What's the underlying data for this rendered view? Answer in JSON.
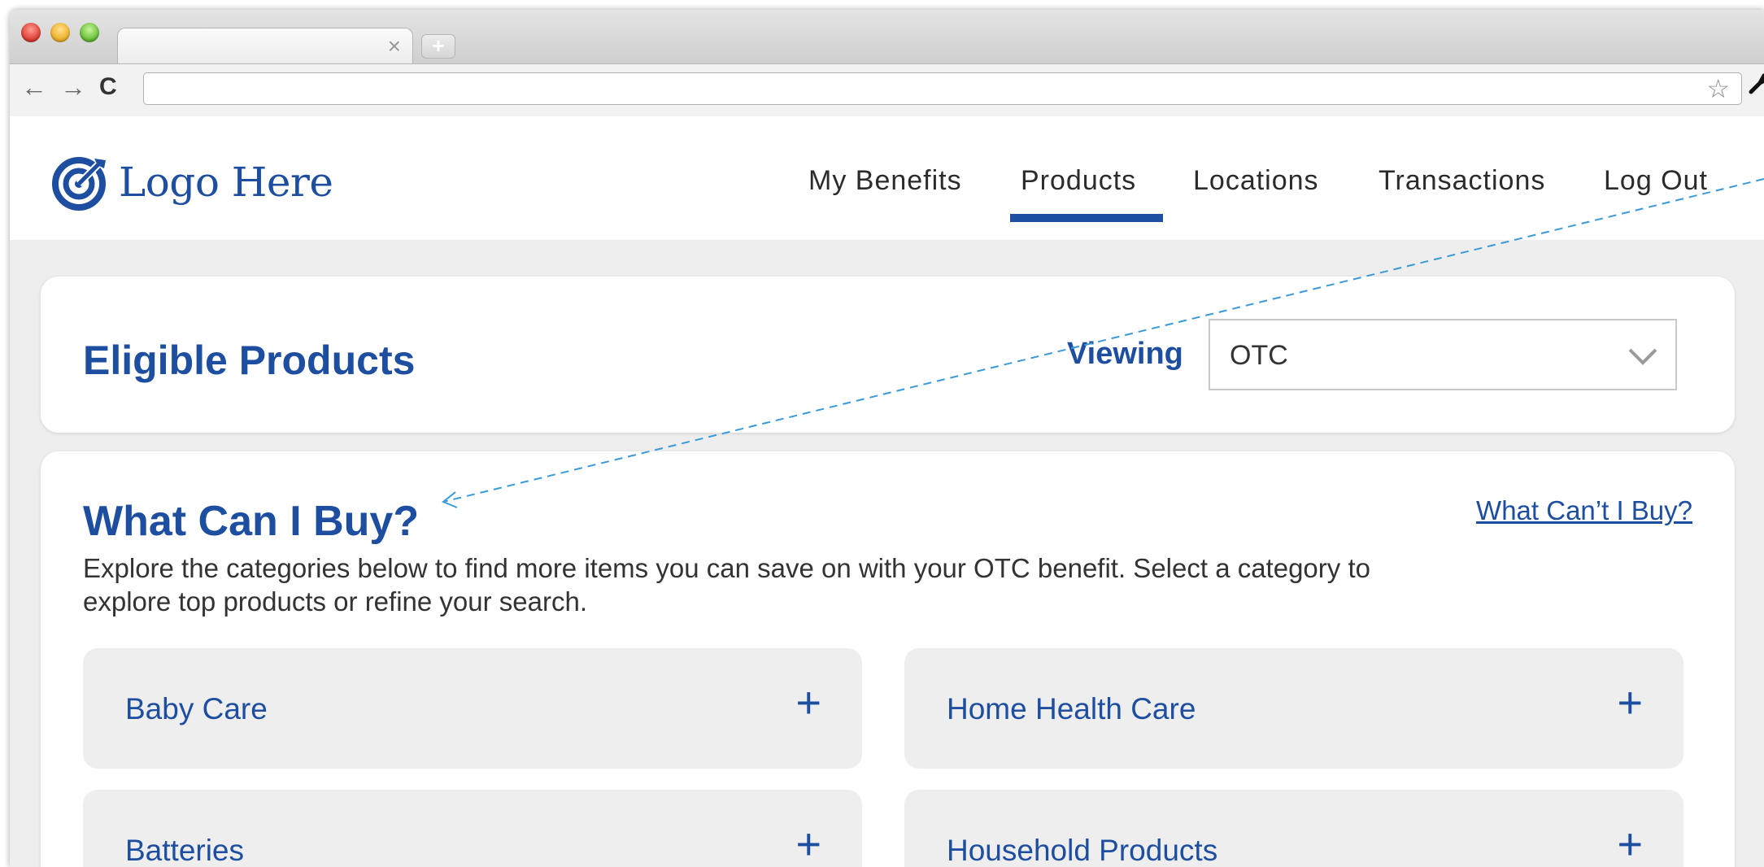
{
  "browser": {
    "tab_close": "×",
    "new_tab": "+",
    "back_icon": "←",
    "forward_icon": "→",
    "reload_icon": "C",
    "star_icon": "☆",
    "wrench_icon": "🔧"
  },
  "header": {
    "logo_text": "Logo Here",
    "nav": [
      {
        "label": "My Benefits"
      },
      {
        "label": "Products",
        "active": true
      },
      {
        "label": "Locations"
      },
      {
        "label": "Transactions"
      },
      {
        "label": "Log Out"
      }
    ]
  },
  "eligible": {
    "title": "Eligible Products",
    "viewing_label": "Viewing",
    "select_value": "OTC"
  },
  "what_can_i_buy": {
    "title": "What Can I Buy?",
    "cant_buy_link": "What Can’t I Buy?",
    "description": "Explore the categories below to find more items you can save on with your OTC benefit. Select a category to explore top products or refine your search.",
    "categories": [
      {
        "label": "Baby Care",
        "icon": "+"
      },
      {
        "label": "Home Health Care",
        "icon": "+"
      },
      {
        "label": "Batteries",
        "icon": "+"
      },
      {
        "label": "Household Products",
        "icon": "+"
      }
    ]
  },
  "colors": {
    "brand_blue": "#1d4ea0",
    "annotation_arrow": "#3a9ad9",
    "page_bg": "#eeeeee"
  }
}
